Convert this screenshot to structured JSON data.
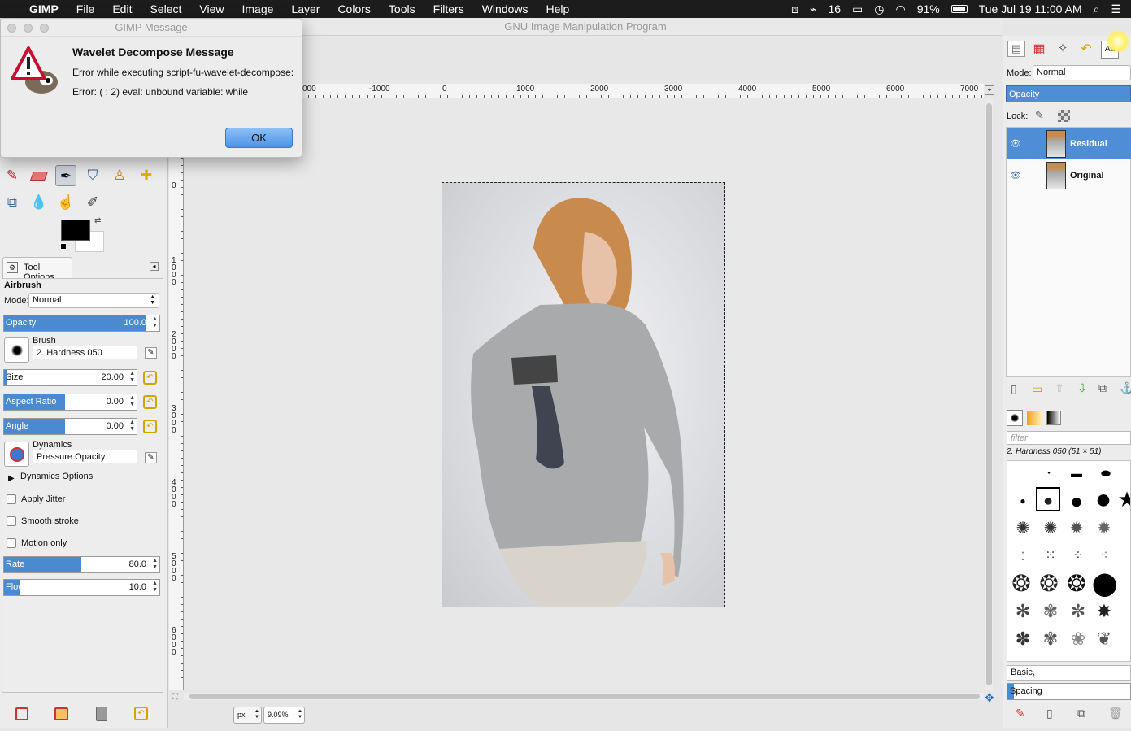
{
  "menubar": {
    "app_name": "GIMP",
    "items": [
      "File",
      "Edit",
      "Select",
      "View",
      "Image",
      "Layer",
      "Colors",
      "Tools",
      "Filters",
      "Windows",
      "Help"
    ],
    "status": {
      "badge_count": "16",
      "battery": "91%",
      "clock": "Tue Jul 19  11:00 AM"
    }
  },
  "dialog": {
    "window_title": "GIMP Message",
    "heading": "Wavelet Decompose  Message",
    "line1": "Error while executing script-fu-wavelet-decompose:",
    "line2": "Error: ( : 2) eval: unbound variable: while",
    "ok_label": "OK"
  },
  "main_window": {
    "title": "GNU Image Manipulation Program"
  },
  "toolbox": {
    "tool_options_tab": "Tool Options",
    "tool_name": "Airbrush",
    "mode_label": "Mode:",
    "mode_value": "Normal",
    "opacity": {
      "label": "Opacity",
      "value": "100.0",
      "fraction": 1.0
    },
    "brush_label": "Brush",
    "brush_value": "2. Hardness 050",
    "size": {
      "label": "Size",
      "value": "20.00",
      "fraction": 0.02
    },
    "aspect_ratio": {
      "label": "Aspect Ratio",
      "value": "0.00",
      "fraction": 0.5
    },
    "angle": {
      "label": "Angle",
      "value": "0.00",
      "fraction": 0.5
    },
    "dynamics_label": "Dynamics",
    "dynamics_value": "Pressure Opacity",
    "dynamics_options": "Dynamics Options",
    "apply_jitter": "Apply Jitter",
    "smooth_stroke": "Smooth stroke",
    "motion_only": "Motion only",
    "rate": {
      "label": "Rate",
      "value": "80.0",
      "fraction": 0.5
    },
    "flow": {
      "label": "Flow",
      "value": "10.0",
      "fraction": 0.1
    }
  },
  "canvas": {
    "ruler_h": [
      "000",
      "-1000",
      "0",
      "1000",
      "2000",
      "3000",
      "4000",
      "5000",
      "6000",
      "7000"
    ],
    "ruler_v": [
      "0",
      "1000",
      "2000",
      "3000",
      "4000",
      "5000",
      "6000"
    ],
    "unit": "px",
    "zoom": "9.09%"
  },
  "layers": {
    "mode_label": "Mode:",
    "mode_value": "Normal",
    "opacity_label": "Opacity",
    "lock_label": "Lock:",
    "items": [
      {
        "name": "Residual",
        "selected": true
      },
      {
        "name": "Original",
        "selected": false
      }
    ]
  },
  "brushes": {
    "filter_placeholder": "filter",
    "current": "2. Hardness 050 (51 × 51)",
    "tag": "Basic,",
    "spacing_label": "Spacing"
  },
  "colors": {
    "accent": "#4a8ad0",
    "selection": "#4f8ed6"
  }
}
